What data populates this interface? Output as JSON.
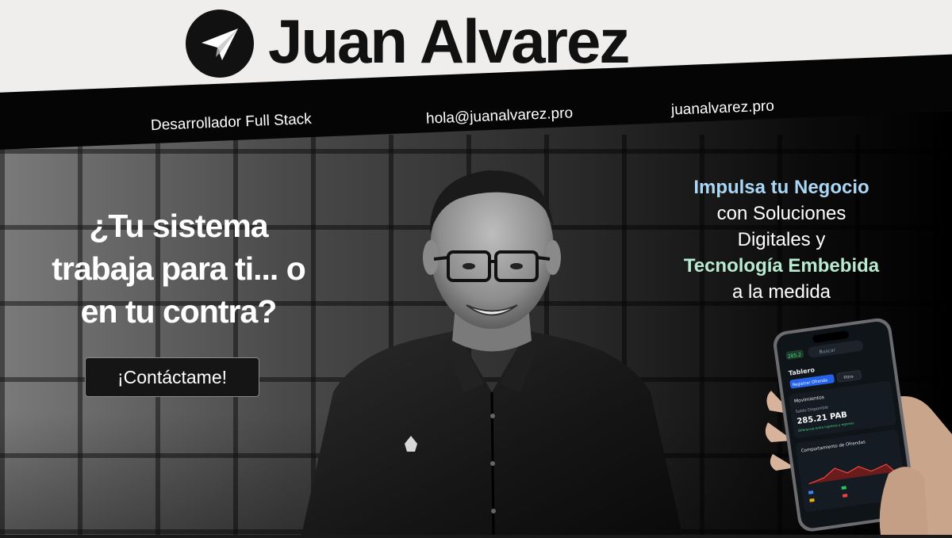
{
  "header": {
    "name": "Juan Alvarez",
    "role": "Desarrollador Full Stack",
    "email": "hola@juanalvarez.pro",
    "website": "juanalvarez.pro"
  },
  "hero": {
    "headline_lines": [
      "¿Tu sistema",
      "trabaja para ti... o",
      "en tu contra?"
    ],
    "cta_label": "¡Contáctame!"
  },
  "tagline": {
    "line1": "Impulsa tu Negocio",
    "line2": "con Soluciones",
    "line3": "Digitales y",
    "line4": "Tecnología Embebida",
    "line5": "a la medida"
  },
  "phone_app": {
    "badge": "285.2",
    "search_placeholder": "Buscar",
    "title": "Tablero",
    "primary_button": "Registrar Ofrenda",
    "filter_button": "Filtro",
    "section_title": "Movimientos",
    "balance_label": "Saldo Disponible",
    "balance_value": "285.21 PAB",
    "balance_note": "Diferencia entre ingresos y egresos",
    "chart_title": "Comportamiento de Ofrendas"
  },
  "colors": {
    "accent_blue": "#a9d7f5",
    "accent_green": "#b9ebd0",
    "header_bg": "#efeeec",
    "stripe_bg": "#050505"
  },
  "icons": {
    "logo": "paper-plane-icon",
    "phone_filter": "filter-icon",
    "phone_search": "search-icon"
  }
}
